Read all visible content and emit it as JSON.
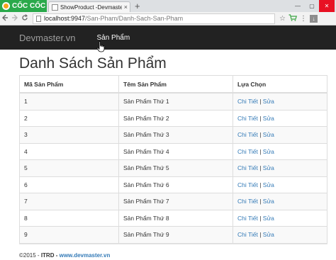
{
  "browser": {
    "brand": "CỐC CỐC",
    "tab_title": "ShowProduct -Devmaster",
    "tab_close": "×",
    "new_tab": "+",
    "url_host": "localhost:9947",
    "url_path": "/San-Pham/Danh-Sach-San-Pham",
    "window_controls": {
      "minimize": "—",
      "maximize": "▢",
      "close": "✕"
    }
  },
  "navbar": {
    "brand": "Devmaster.vn",
    "link": "Sản Phẩm"
  },
  "page": {
    "title": "Danh Sách Sản Phẩm"
  },
  "table": {
    "columns": [
      "Mã Sản Phẩm",
      "Têm Sản Phẩm",
      "Lựa Chọn"
    ],
    "detail_label": "Chi Tiết",
    "separator": "|",
    "edit_label": "Sửa",
    "rows": [
      {
        "id": "1",
        "name": "Sản Phẩm Thứ 1"
      },
      {
        "id": "2",
        "name": "Sản Phẩm Thứ 2"
      },
      {
        "id": "3",
        "name": "Sản Phẩm Thứ 3"
      },
      {
        "id": "4",
        "name": "Sản Phẩm Thứ 4"
      },
      {
        "id": "5",
        "name": "Sản Phẩm Thứ 5"
      },
      {
        "id": "6",
        "name": "Sản Phẩm Thứ 6"
      },
      {
        "id": "7",
        "name": "Sản Phẩm Thứ 7"
      },
      {
        "id": "8",
        "name": "Sản Phẩm Thứ 8"
      },
      {
        "id": "9",
        "name": "Sản Phẩm Thứ 9"
      }
    ]
  },
  "footer": {
    "copyright": "©2015 - ",
    "org": "ITRD",
    "dash": " - ",
    "site": "www.devmaster.vn"
  },
  "colors": {
    "navbar_bg": "#222222",
    "link": "#337ab7",
    "brand_green": "#2aa94b"
  }
}
